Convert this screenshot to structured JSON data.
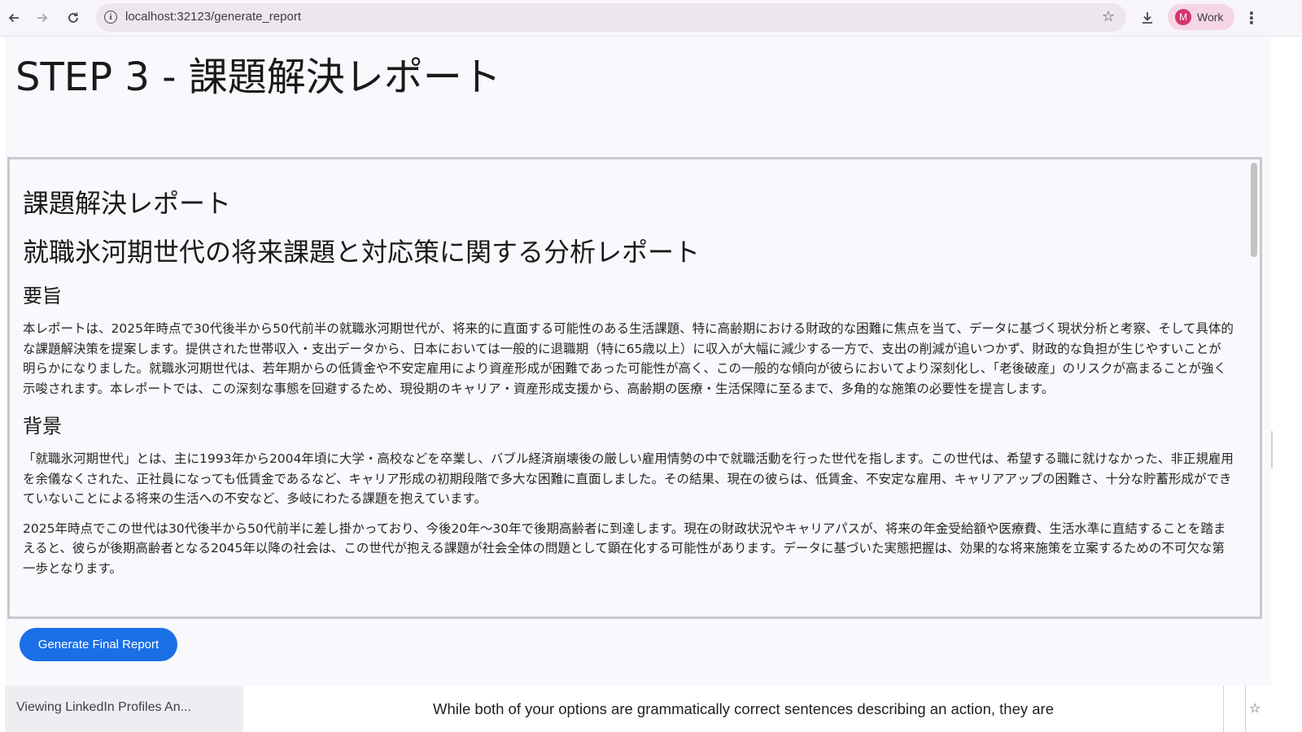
{
  "browser": {
    "url": "localhost:32123/generate_report",
    "profile_initial": "M",
    "profile_label": "Work",
    "icons": {
      "back": "arrow-left-icon",
      "forward": "arrow-right-icon",
      "reload": "reload-icon",
      "site_info": "info-icon",
      "bookmark": "star-icon",
      "download": "download-icon",
      "menu": "kebab-menu-icon"
    }
  },
  "page": {
    "title": "STEP 3 - 課題解決レポート",
    "report": {
      "heading": "課題解決レポート",
      "subtitle": "就職氷河期世代の将来課題と対応策に関する分析レポート",
      "sections": [
        {
          "heading": "要旨",
          "paragraphs": [
            "本レポートは、2025年時点で30代後半から50代前半の就職氷河期世代が、将来的に直面する可能性のある生活課題、特に高齢期における財政的な困難に焦点を当て、データに基づく現状分析と考察、そして具体的な課題解決策を提案します。提供された世帯収入・支出データから、日本においては一般的に退職期（特に65歳以上）に収入が大幅に減少する一方で、支出の削減が追いつかず、財政的な負担が生じやすいことが明らかになりました。就職氷河期世代は、若年期からの低賃金や不安定雇用により資産形成が困難であった可能性が高く、この一般的な傾向が彼らにおいてより深刻化し、「老後破産」のリスクが高まることが強く示唆されます。本レポートでは、この深刻な事態を回避するため、現役期のキャリア・資産形成支援から、高齢期の医療・生活保障に至るまで、多角的な施策の必要性を提言します。"
          ]
        },
        {
          "heading": "背景",
          "paragraphs": [
            "「就職氷河期世代」とは、主に1993年から2004年頃に大学・高校などを卒業し、バブル経済崩壊後の厳しい雇用情勢の中で就職活動を行った世代を指します。この世代は、希望する職に就けなかった、非正規雇用を余儀なくされた、正社員になっても低賃金であるなど、キャリア形成の初期段階で多大な困難に直面しました。その結果、現在の彼らは、低賃金、不安定な雇用、キャリアアップの困難さ、十分な貯蓄形成ができていないことによる将来の生活への不安など、多岐にわたる課題を抱えています。",
            "2025年時点でこの世代は30代後半から50代前半に差し掛かっており、今後20年〜30年で後期高齢者に到達します。現在の財政状況やキャリアパスが、将来の年金受給額や医療費、生活水準に直結することを踏まえると、彼らが後期高齢者となる2045年以降の社会は、この世代が抱える課題が社会全体の問題として顕在化する可能性があります。データに基づいた実態把握は、効果的な将来施策を立案するための不可欠な第一歩となります。"
          ]
        }
      ]
    },
    "generate_button_label": "Generate Final Report"
  },
  "overlay": {
    "tab_label": "Viewing LinkedIn Profiles An...",
    "snippet": "While both of your options are grammatically correct sentences describing an action, they are"
  }
}
